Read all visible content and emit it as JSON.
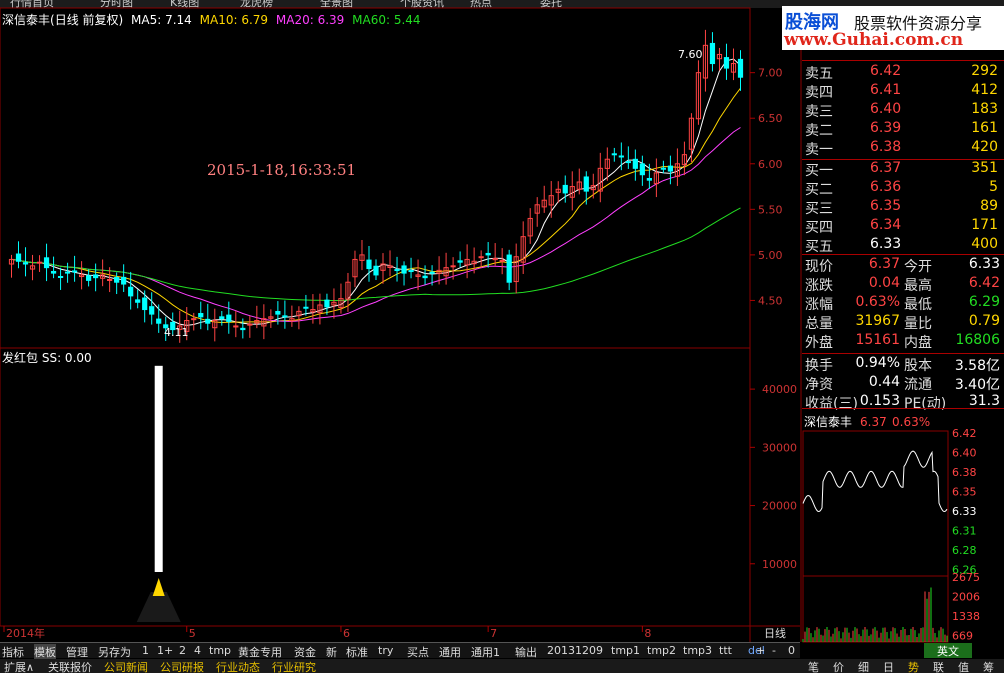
{
  "stock": {
    "name": "深信泰丰",
    "period": "(日线 前复权)",
    "ma5": "MA5: 7.14",
    "ma10": "MA10: 6.79",
    "ma20": "MA20: 6.39",
    "ma60": "MA60: 5.44",
    "indicator_label": "发红包",
    "indicator_value": "SS: 0.00",
    "datetime_label": "2015-1-18,16:33:51",
    "high_label": "7.60",
    "low_label": "4.11",
    "axis_period": "日线"
  },
  "colors": {
    "up": "#ff4444",
    "down": "#00ffff",
    "ma5": "#ffffff",
    "ma10": "#ffd700",
    "ma20": "#ff40ff",
    "ma60": "#22dd22",
    "grid": "#aa0000"
  },
  "logo": {
    "main": "股海网",
    "side": "股票软件资源分享",
    "url": "www.Guhai.com.cn"
  },
  "chart_data": {
    "type": "candlestick",
    "price_axis": [
      "7.00",
      "6.50",
      "6.00",
      "5.50",
      "5.00",
      "4.50"
    ],
    "price_ticks": [
      7.0,
      6.5,
      6.0,
      5.5,
      5.0,
      4.5
    ],
    "ylim": [
      4.0,
      7.6
    ],
    "volume_axis": [
      "40000",
      "30000",
      "20000",
      "10000"
    ],
    "volume_ticks": [
      40000,
      30000,
      20000,
      10000
    ],
    "volume_ylim": [
      0,
      45000
    ],
    "time_labels": [
      "2014年",
      "5",
      "6",
      "7",
      "8"
    ],
    "time_label_index": [
      0,
      25,
      47,
      68,
      90
    ],
    "closes": [
      4.95,
      4.93,
      4.9,
      4.88,
      4.92,
      4.86,
      4.8,
      4.76,
      4.8,
      4.82,
      4.78,
      4.72,
      4.75,
      4.78,
      4.73,
      4.7,
      4.68,
      4.55,
      4.48,
      4.4,
      4.35,
      4.25,
      4.2,
      4.18,
      4.22,
      4.28,
      4.3,
      4.32,
      4.25,
      4.28,
      4.3,
      4.27,
      4.22,
      4.18,
      4.24,
      4.28,
      4.3,
      4.32,
      4.35,
      4.33,
      4.3,
      4.38,
      4.42,
      4.4,
      4.45,
      4.43,
      4.48,
      4.52,
      4.7,
      4.95,
      5.0,
      4.85,
      4.78,
      4.9,
      4.88,
      4.83,
      4.8,
      4.82,
      4.78,
      4.75,
      4.8,
      4.83,
      4.86,
      4.88,
      4.92,
      4.95,
      4.93,
      4.98,
      5.0,
      4.96,
      4.94,
      4.7,
      4.98,
      5.2,
      5.4,
      5.55,
      5.6,
      5.65,
      5.72,
      5.68,
      5.75,
      5.8,
      5.7,
      5.76,
      5.95,
      6.05,
      6.1,
      6.08,
      6.02,
      5.95,
      5.88,
      5.82,
      5.9,
      5.95,
      5.92,
      6.0,
      6.1,
      6.5,
      7.0,
      7.3,
      7.1,
      7.2,
      7.05,
      7.1,
      6.95
    ],
    "volumes": [
      0,
      0,
      0,
      0,
      0,
      0,
      0,
      0,
      0,
      0,
      0,
      0,
      0,
      0,
      0,
      0,
      0,
      0,
      0,
      0,
      0,
      0,
      0,
      0,
      0,
      0,
      0,
      0,
      0,
      0,
      0,
      0,
      0,
      0,
      0,
      0,
      0,
      0,
      0,
      0,
      0,
      0,
      0,
      0,
      0,
      0,
      0,
      0,
      0,
      0,
      0,
      0,
      0,
      0,
      0,
      0,
      0,
      0,
      0,
      0,
      0,
      0,
      0,
      0,
      0,
      0,
      0,
      0,
      0,
      0,
      0,
      0,
      0,
      0,
      0,
      0,
      0,
      0,
      0,
      0,
      0,
      0,
      0,
      0,
      0,
      0,
      0,
      0,
      0,
      0,
      0,
      0,
      0,
      0,
      0,
      0,
      0,
      0,
      0,
      0,
      0,
      0,
      0,
      0,
      0
    ],
    "red_packet_index": 21,
    "red_packet_value": 44000
  },
  "quote": {
    "asks": [
      {
        "label": "卖五",
        "price": "6.42",
        "vol": "292"
      },
      {
        "label": "卖四",
        "price": "6.41",
        "vol": "412"
      },
      {
        "label": "卖三",
        "price": "6.40",
        "vol": "183"
      },
      {
        "label": "卖二",
        "price": "6.39",
        "vol": "161"
      },
      {
        "label": "卖一",
        "price": "6.38",
        "vol": "420"
      }
    ],
    "bids": [
      {
        "label": "买一",
        "price": "6.37",
        "vol": "351"
      },
      {
        "label": "买二",
        "price": "6.36",
        "vol": "5"
      },
      {
        "label": "买三",
        "price": "6.35",
        "vol": "89"
      },
      {
        "label": "买四",
        "price": "6.34",
        "vol": "171"
      },
      {
        "label": "买五",
        "price": "6.33",
        "vol": "400"
      }
    ],
    "stats": [
      {
        "l1": "现价",
        "v1": "6.37",
        "c1": "red",
        "l2": "今开",
        "v2": "6.33",
        "c2": "white"
      },
      {
        "l1": "涨跌",
        "v1": "0.04",
        "c1": "red",
        "l2": "最高",
        "v2": "6.42",
        "c2": "red"
      },
      {
        "l1": "涨幅",
        "v1": "0.63%",
        "c1": "red",
        "l2": "最低",
        "v2": "6.29",
        "c2": "green"
      },
      {
        "l1": "总量",
        "v1": "31967",
        "c1": "yellow",
        "l2": "量比",
        "v2": "0.79",
        "c2": "yellow"
      },
      {
        "l1": "外盘",
        "v1": "15161",
        "c1": "red",
        "l2": "内盘",
        "v2": "16806",
        "c2": "green"
      },
      {
        "l1": "换手",
        "v1": "0.94%",
        "c1": "white",
        "l2": "股本",
        "v2": "3.58亿",
        "c2": "white"
      },
      {
        "l1": "净资",
        "v1": "0.44",
        "c1": "white",
        "l2": "流通",
        "v2": "3.40亿",
        "c2": "white"
      },
      {
        "l1": "收益(三)",
        "v1": "0.153",
        "c1": "white",
        "l2": "PE(动)",
        "v2": "31.3",
        "c2": "white"
      }
    ]
  },
  "mini": {
    "title": "深信泰丰",
    "price": "6.37",
    "pct": "0.63%",
    "price_ticks": [
      "6.42",
      "6.40",
      "6.38",
      "6.35",
      "6.33",
      "6.31",
      "6.28",
      "6.26"
    ],
    "vol_ticks": [
      "2675",
      "2006",
      "1338",
      "669"
    ]
  },
  "toolbar": {
    "items": [
      "指标",
      "模板",
      "管理",
      "另存为",
      "1",
      "1+",
      "2",
      "4",
      "tmp",
      "黄金专用",
      "资金",
      "新",
      "标准",
      "try",
      "买点",
      "通用",
      "通用1",
      "输出",
      "20131209",
      "tmp1",
      "tmp2",
      "tmp3",
      "ttt",
      "del"
    ],
    "right": [
      "+",
      "-",
      "0"
    ],
    "yingwen": "英文"
  },
  "status": {
    "items": [
      "扩展∧",
      "关联报价",
      "公司新闻",
      "公司研报",
      "行业动态",
      "行业研究"
    ],
    "mini_tabs": [
      "笔",
      "价",
      "细",
      "日",
      "势",
      "联",
      "值",
      "筹"
    ]
  },
  "menu": [
    "行情首页",
    "分时图",
    "K线图",
    "龙虎榜",
    "全景图",
    "个股资讯",
    "热点",
    "委托"
  ]
}
